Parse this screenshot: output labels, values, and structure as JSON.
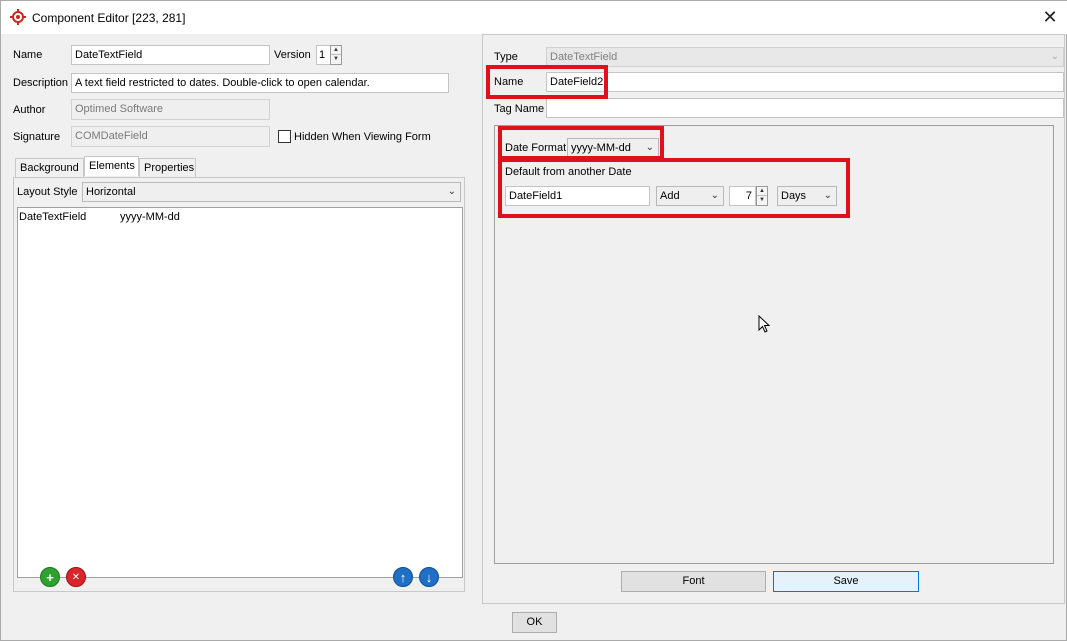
{
  "window": {
    "title": "Component Editor [223, 281]",
    "close_glyph": "✕",
    "app_icon": "target-gear-icon"
  },
  "left": {
    "name_label": "Name",
    "name_value": "DateTextField",
    "version_label": "Version",
    "version_value": "1",
    "description_label": "Description",
    "description_value": "A text field restricted to dates.  Double-click to open calendar.",
    "author_label": "Author",
    "author_value": "Optimed Software",
    "signature_label": "Signature",
    "signature_value": "COMDateField",
    "hidden_label": "Hidden When Viewing Form",
    "tabs": [
      "Background",
      "Elements",
      "Properties"
    ],
    "active_tab": "Elements",
    "layout_style_label": "Layout Style",
    "layout_style_value": "Horizontal",
    "elements": [
      {
        "name": "DateTextField",
        "value": "yyyy-MM-dd"
      }
    ],
    "add_glyph": "+",
    "remove_glyph": "✕",
    "up_glyph": "↑",
    "down_glyph": "↓"
  },
  "right": {
    "type_label": "Type",
    "type_value": "DateTextField",
    "name_label": "Name",
    "name_value": "DateField2",
    "tag_label": "Tag Name",
    "tag_value": "",
    "date_format_label": "Date Format",
    "date_format_value": "yyyy-MM-dd",
    "default_label": "Default from another Date",
    "default_field_value": "DateField1",
    "operation_value": "Add",
    "amount_value": "7",
    "unit_value": "Days",
    "font_button": "Font",
    "save_button": "Save"
  },
  "footer": {
    "ok_button": "OK"
  },
  "colors": {
    "highlight": "#e0111a",
    "add_icon": "#2ea12e",
    "remove_icon": "#d9262a",
    "arrow_icon": "#1f6fc5"
  }
}
